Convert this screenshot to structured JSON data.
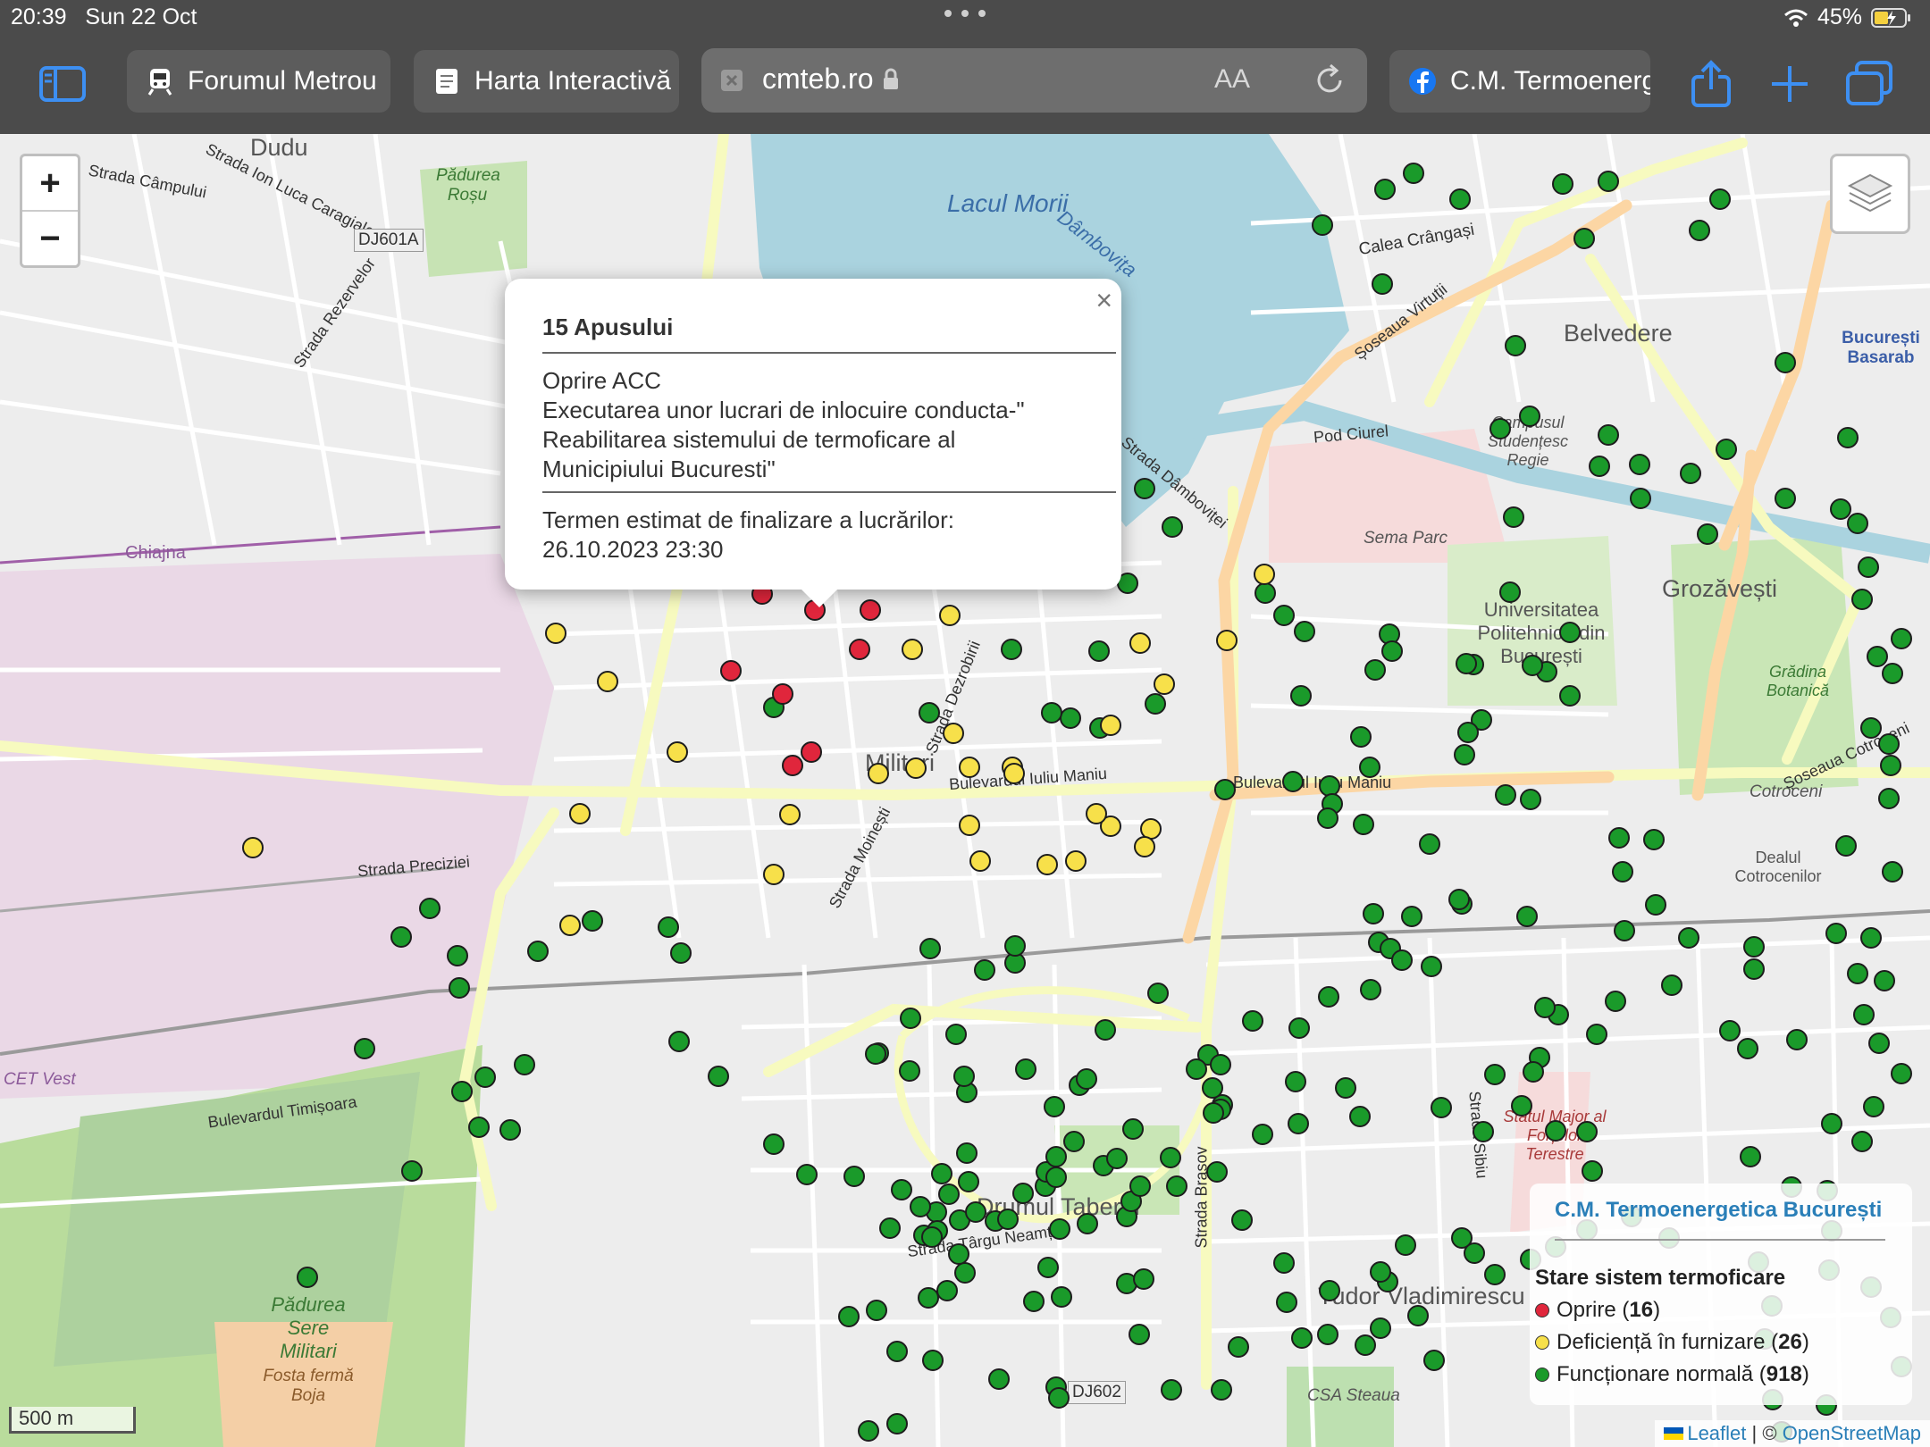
{
  "status": {
    "time": "20:39",
    "date": "Sun 22 Oct",
    "battery": "45%"
  },
  "tabs": [
    {
      "label": "Forumul Metrou",
      "icon": "train-icon"
    },
    {
      "label": "Harta Interactivă",
      "icon": "document-icon"
    },
    {
      "label": "C.M. Termoenerg",
      "icon": "facebook-icon"
    }
  ],
  "address": {
    "domain": "cmteb.ro",
    "reader": "AA"
  },
  "zoom": {
    "in": "+",
    "out": "−"
  },
  "popup": {
    "close": "×",
    "title": "15 Apusului",
    "lines": [
      "Oprire ACC",
      "Executarea unor lucrari de inlocuire conducta-\"",
      "Reabilitarea sistemului de termoficare al",
      "Municipiului Bucuresti\""
    ],
    "term_label": "Termen estimat de finalizare a lucrărilor:",
    "term_value": "26.10.2023 23:30"
  },
  "legend": {
    "header": "C.M. Termoenergetica București",
    "title": "Stare sistem termoficare",
    "items": [
      {
        "label": "Oprire",
        "count": "16",
        "color": "#e0263c"
      },
      {
        "label": "Deficiență în furnizare",
        "count": "26",
        "color": "#f7e04a"
      },
      {
        "label": "Funcționare normală",
        "count": "918",
        "color": "#1a9a2a"
      }
    ]
  },
  "scale": "500 m",
  "attribution": {
    "leaflet": "Leaflet",
    "sep": "| ©",
    "osm": "OpenStreetMap"
  },
  "map_labels": [
    "Dudu",
    "Pădurea Roșu",
    "Strada Câmpului",
    "Strada Ion Luca Caragiale",
    "DJ601A",
    "Strada Rezervelor",
    "Lacul Morii",
    "Dâmbovița",
    "Calea Crângași",
    "Șoseaua Virtuții",
    "Belvedere",
    "București Basarab",
    "Pod Ciurel",
    "Campusul Studențesc Regie",
    "Sema Parc",
    "Grozăvești",
    "Universitatea Politehnica din București",
    "Grădina Botanică",
    "Cotroceni",
    "Militari",
    "Bulevardul Iuliu Maniu",
    "Strada Dezrobirii",
    "Strada Moinești",
    "Strada Preciziei",
    "Chiajna",
    "CET Vest",
    "Bulevardul Timișoara",
    "Drumul Taberei",
    "Strada Târgu Neamț",
    "Tudor Vladimirescu",
    "Pădurea Sere Militari",
    "Fosta fermă Boja",
    "DJ602",
    "CSA Steaua",
    "Statul Major al Forțelor Terestre",
    "Strada Sibiu",
    "Strada Brașov",
    "Dealul Cotrocenilor",
    "Șoseaua Cotroceni",
    "Strada Dâmboviței"
  ],
  "markers": {
    "red": [
      [
        853,
        515
      ],
      [
        912,
        533
      ],
      [
        974,
        533
      ],
      [
        962,
        577
      ],
      [
        818,
        601
      ],
      [
        876,
        627
      ],
      [
        908,
        692
      ],
      [
        887,
        707
      ]
    ],
    "yellow": [
      [
        1063,
        539
      ],
      [
        1021,
        577
      ],
      [
        622,
        559
      ],
      [
        680,
        613
      ],
      [
        1276,
        570
      ],
      [
        1303,
        616
      ],
      [
        1243,
        662
      ],
      [
        1067,
        671
      ],
      [
        1133,
        709
      ],
      [
        1085,
        774
      ],
      [
        1025,
        710
      ],
      [
        983,
        716
      ],
      [
        884,
        762
      ],
      [
        758,
        692
      ],
      [
        649,
        761
      ],
      [
        1243,
        775
      ],
      [
        866,
        829
      ],
      [
        1097,
        814
      ],
      [
        1172,
        818
      ],
      [
        1204,
        814
      ],
      [
        1288,
        778
      ],
      [
        1281,
        798
      ],
      [
        283,
        799
      ],
      [
        638,
        886
      ],
      [
        1415,
        493
      ],
      [
        1373,
        567
      ],
      [
        1135,
        716
      ],
      [
        1227,
        761
      ],
      [
        1085,
        709
      ]
    ],
    "green": [
      [
        1550,
        62
      ],
      [
        1582,
        44
      ],
      [
        1634,
        73
      ],
      [
        1480,
        102
      ],
      [
        1749,
        56
      ],
      [
        1800,
        53
      ],
      [
        1925,
        73
      ],
      [
        1902,
        108
      ],
      [
        1773,
        117
      ],
      [
        1547,
        168
      ],
      [
        1696,
        237
      ],
      [
        1998,
        256
      ],
      [
        1712,
        316
      ],
      [
        1679,
        330
      ],
      [
        1800,
        337
      ],
      [
        1835,
        370
      ],
      [
        1892,
        380
      ],
      [
        1932,
        353
      ],
      [
        1790,
        372
      ],
      [
        2068,
        340
      ],
      [
        1694,
        429
      ],
      [
        1281,
        397
      ],
      [
        1312,
        440
      ],
      [
        1262,
        503
      ],
      [
        1690,
        513
      ],
      [
        1416,
        514
      ],
      [
        1437,
        539
      ],
      [
        1460,
        557
      ],
      [
        1757,
        558
      ],
      [
        1555,
        560
      ],
      [
        1539,
        600
      ],
      [
        1558,
        579
      ],
      [
        1230,
        579
      ],
      [
        1132,
        577
      ],
      [
        1293,
        638
      ],
      [
        1198,
        654
      ],
      [
        1177,
        648
      ],
      [
        1231,
        665
      ],
      [
        1040,
        648
      ],
      [
        866,
        642
      ],
      [
        1649,
        594
      ],
      [
        1641,
        593
      ],
      [
        1731,
        602
      ],
      [
        1715,
        595
      ],
      [
        1757,
        629
      ],
      [
        1658,
        656
      ],
      [
        1643,
        670
      ],
      [
        1639,
        695
      ],
      [
        1533,
        709
      ],
      [
        1523,
        675
      ],
      [
        1456,
        629
      ],
      [
        1488,
        730
      ],
      [
        1685,
        740
      ],
      [
        1713,
        745
      ],
      [
        1371,
        734
      ],
      [
        1447,
        725
      ],
      [
        1491,
        750
      ],
      [
        1486,
        766
      ],
      [
        1526,
        773
      ],
      [
        1812,
        788
      ],
      [
        1851,
        790
      ],
      [
        1816,
        826
      ],
      [
        1853,
        863
      ],
      [
        1636,
        862
      ],
      [
        1600,
        795
      ],
      [
        1537,
        873
      ],
      [
        1543,
        905
      ],
      [
        1580,
        876
      ],
      [
        1556,
        912
      ],
      [
        1633,
        857
      ],
      [
        1709,
        876
      ],
      [
        1818,
        892
      ],
      [
        1890,
        900
      ],
      [
        1963,
        910
      ],
      [
        2055,
        895
      ],
      [
        2094,
        900
      ],
      [
        2079,
        940
      ],
      [
        2109,
        948
      ],
      [
        1963,
        935
      ],
      [
        2086,
        986
      ],
      [
        2103,
        1018
      ],
      [
        1936,
        1004
      ],
      [
        1871,
        953
      ],
      [
        1808,
        971
      ],
      [
        1744,
        986
      ],
      [
        1723,
        1034
      ],
      [
        1716,
        1050
      ],
      [
        1703,
        1088
      ],
      [
        1741,
        1116
      ],
      [
        1776,
        1117
      ],
      [
        1782,
        1161
      ],
      [
        1660,
        1117
      ],
      [
        1613,
        1090
      ],
      [
        1522,
        1100
      ],
      [
        1506,
        1068
      ],
      [
        1453,
        1108
      ],
      [
        1413,
        1120
      ],
      [
        1368,
        1087
      ],
      [
        1362,
        1162
      ],
      [
        1317,
        1178
      ],
      [
        1310,
        1146
      ],
      [
        1268,
        1114
      ],
      [
        1235,
        1155
      ],
      [
        1261,
        1212
      ],
      [
        1217,
        1220
      ],
      [
        1186,
        1226
      ],
      [
        1170,
        1178
      ],
      [
        1082,
        1141
      ],
      [
        1054,
        1164
      ],
      [
        1048,
        1207
      ],
      [
        1034,
        1233
      ],
      [
        996,
        1225
      ],
      [
        1074,
        1216
      ],
      [
        1173,
        1269
      ],
      [
        1261,
        1287
      ],
      [
        1188,
        1302
      ],
      [
        1157,
        1307
      ],
      [
        1039,
        1303
      ],
      [
        981,
        1317
      ],
      [
        950,
        1324
      ],
      [
        1004,
        1363
      ],
      [
        1044,
        1373
      ],
      [
        1182,
        1403
      ],
      [
        1280,
        1282
      ],
      [
        1553,
        1285
      ],
      [
        1573,
        1244
      ],
      [
        1390,
        1216
      ],
      [
        1437,
        1264
      ],
      [
        1488,
        1295
      ],
      [
        1545,
        1274
      ],
      [
        1636,
        1236
      ],
      [
        1650,
        1253
      ],
      [
        1673,
        1277
      ],
      [
        1605,
        1373
      ],
      [
        1587,
        1323
      ],
      [
        1545,
        1337
      ],
      [
        1528,
        1356
      ],
      [
        1486,
        1344
      ],
      [
        1457,
        1348
      ],
      [
        1440,
        1308
      ],
      [
        1386,
        1358
      ],
      [
        1367,
        1406
      ],
      [
        1311,
        1406
      ],
      [
        1275,
        1344
      ],
      [
        1185,
        1415
      ],
      [
        1118,
        1394
      ],
      [
        972,
        1452
      ],
      [
        1004,
        1444
      ],
      [
        1060,
        1295
      ],
      [
        1080,
        1275
      ],
      [
        1073,
        1254
      ],
      [
        1092,
        1207
      ],
      [
        1114,
        1217
      ],
      [
        1145,
        1186
      ],
      [
        1171,
        1162
      ],
      [
        1182,
        1168
      ],
      [
        1182,
        1145
      ],
      [
        1128,
        1215
      ],
      [
        1084,
        1173
      ],
      [
        1062,
        1187
      ],
      [
        1049,
        1228
      ],
      [
        1043,
        1235
      ],
      [
        1030,
        1201
      ],
      [
        1009,
        1182
      ],
      [
        956,
        1167
      ],
      [
        903,
        1165
      ],
      [
        866,
        1131
      ],
      [
        1250,
        1147
      ],
      [
        1202,
        1128
      ],
      [
        1180,
        1089
      ],
      [
        1148,
        1047
      ],
      [
        1082,
        1073
      ],
      [
        1079,
        1055
      ],
      [
        1018,
        1049
      ],
      [
        1070,
        1008
      ],
      [
        1102,
        936
      ],
      [
        1136,
        928
      ],
      [
        1136,
        909
      ],
      [
        1041,
        912
      ],
      [
        1019,
        990
      ],
      [
        983,
        1029
      ],
      [
        980,
        1030
      ],
      [
        804,
        1055
      ],
      [
        760,
        1016
      ],
      [
        762,
        917
      ],
      [
        748,
        888
      ],
      [
        663,
        881
      ],
      [
        602,
        915
      ],
      [
        587,
        1042
      ],
      [
        543,
        1056
      ],
      [
        514,
        956
      ],
      [
        512,
        920
      ],
      [
        517,
        1072
      ],
      [
        536,
        1112
      ],
      [
        571,
        1115
      ],
      [
        481,
        867
      ],
      [
        449,
        899
      ],
      [
        408,
        1024
      ],
      [
        461,
        1161
      ],
      [
        344,
        1280
      ],
      [
        1266,
        1195
      ],
      [
        1276,
        1178
      ],
      [
        1208,
        1065
      ],
      [
        1216,
        1058
      ],
      [
        1237,
        1003
      ],
      [
        1296,
        962
      ],
      [
        1352,
        1031
      ],
      [
        1402,
        993
      ],
      [
        1450,
        1061
      ],
      [
        1366,
        1092
      ],
      [
        1339,
        1047
      ],
      [
        1366,
        1042
      ],
      [
        1357,
        1068
      ],
      [
        1358,
        1096
      ],
      [
        1454,
        1001
      ],
      [
        1487,
        966
      ],
      [
        1534,
        958
      ],
      [
        1569,
        925
      ],
      [
        1602,
        932
      ],
      [
        1673,
        1053
      ],
      [
        1729,
        978
      ],
      [
        1787,
        1008
      ],
      [
        2011,
        1014
      ],
      [
        1956,
        1024
      ],
      [
        1959,
        1145
      ],
      [
        2005,
        1179
      ],
      [
        2050,
        1228
      ],
      [
        1968,
        1263
      ],
      [
        1983,
        1312
      ],
      [
        1975,
        1349
      ],
      [
        2047,
        1272
      ],
      [
        2045,
        1183
      ],
      [
        2050,
        1108
      ],
      [
        2097,
        1089
      ],
      [
        2128,
        1052
      ],
      [
        2118,
        826
      ],
      [
        2066,
        797
      ],
      [
        2114,
        744
      ],
      [
        2116,
        707
      ],
      [
        2114,
        683
      ],
      [
        2094,
        665
      ],
      [
        2118,
        604
      ],
      [
        2101,
        585
      ],
      [
        2128,
        565
      ],
      [
        2084,
        521
      ],
      [
        2091,
        485
      ],
      [
        2079,
        436
      ],
      [
        2060,
        420
      ],
      [
        1998,
        408
      ],
      [
        1836,
        408
      ],
      [
        1911,
        448
      ],
      [
        2084,
        1128
      ],
      [
        1868,
        1236
      ],
      [
        1826,
        1212
      ],
      [
        1776,
        1227
      ],
      [
        1741,
        1246
      ],
      [
        1713,
        1260
      ],
      [
        2094,
        1291
      ],
      [
        2116,
        1325
      ],
      [
        2128,
        1380
      ],
      [
        1984,
        1417
      ],
      [
        1994,
        1453
      ],
      [
        2044,
        1423
      ]
    ]
  }
}
